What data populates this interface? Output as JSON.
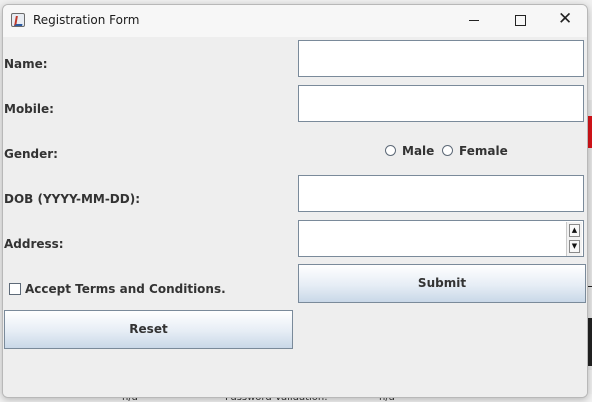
{
  "window": {
    "title": "Registration Form",
    "controls": {
      "minimize": "–",
      "maximize": "☐",
      "close": "✕"
    }
  },
  "form": {
    "name_label": "Name:",
    "name_value": "",
    "mobile_label": "Mobile:",
    "mobile_value": "",
    "gender_label": "Gender:",
    "gender_options": [
      "Male",
      "Female"
    ],
    "dob_label": "DOB (YYYY-MM-DD):",
    "dob_value": "",
    "address_label": "Address:",
    "address_value": "",
    "terms_label": "Accept Terms and Conditions.",
    "terms_checked": false,
    "submit_label": "Submit",
    "reset_label": "Reset"
  },
  "background": {
    "bottom_texts": [
      "n/a",
      "Password Validation:",
      "n/a"
    ]
  },
  "colors": {
    "accent": "#c9d8e8",
    "border": "#7a8a9a",
    "background_red": "#d8141a"
  }
}
